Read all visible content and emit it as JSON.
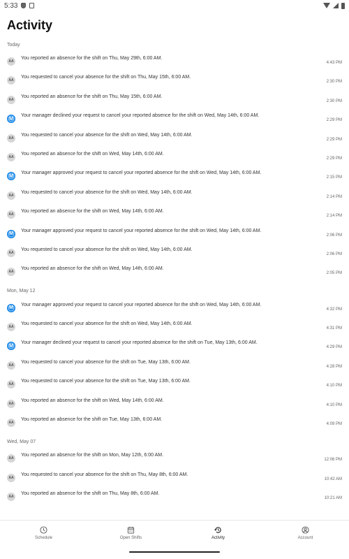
{
  "status_bar": {
    "time": "5:33"
  },
  "title": "Activity",
  "sections": [
    {
      "header": "Today",
      "rows": [
        {
          "avatar": "AA",
          "kind": "user",
          "text": "You reported an absence for the shift on Thu, May 29th, 6:00 AM.",
          "time": "4:43 PM"
        },
        {
          "avatar": "AA",
          "kind": "user",
          "text": "You requested to cancel your absence for the shift on Thu, May 15th, 6:00 AM.",
          "time": "2:30 PM"
        },
        {
          "avatar": "AA",
          "kind": "user",
          "text": "You reported an absence for the shift on Thu, May 15th, 6:00 AM.",
          "time": "2:30 PM"
        },
        {
          "avatar": "M",
          "kind": "manager",
          "text": "Your manager declined your request to cancel your reported absence for the shift on Wed, May 14th, 6:00 AM.",
          "time": "2:29 PM"
        },
        {
          "avatar": "AA",
          "kind": "user",
          "text": "You requested to cancel your absence for the shift on Wed, May 14th, 6:00 AM.",
          "time": "2:29 PM"
        },
        {
          "avatar": "AA",
          "kind": "user",
          "text": "You reported an absence for the shift on Wed, May 14th, 6:00 AM.",
          "time": "2:29 PM"
        },
        {
          "avatar": "M",
          "kind": "manager",
          "text": "Your manager approved your request to cancel your reported absence for the shift on Wed, May 14th, 6:00 AM.",
          "time": "2:15 PM"
        },
        {
          "avatar": "AA",
          "kind": "user",
          "text": "You requested to cancel your absence for the shift on Wed, May 14th, 6:00 AM.",
          "time": "2:14 PM"
        },
        {
          "avatar": "AA",
          "kind": "user",
          "text": "You reported an absence for the shift on Wed, May 14th, 6:00 AM.",
          "time": "2:14 PM"
        },
        {
          "avatar": "M",
          "kind": "manager",
          "text": "Your manager approved your request to cancel your reported absence for the shift on Wed, May 14th, 6:00 AM.",
          "time": "2:06 PM"
        },
        {
          "avatar": "AA",
          "kind": "user",
          "text": "You requested to cancel your absence for the shift on Wed, May 14th, 6:00 AM.",
          "time": "2:06 PM"
        },
        {
          "avatar": "AA",
          "kind": "user",
          "text": "You reported an absence for the shift on Wed, May 14th, 6:00 AM.",
          "time": "2:05 PM"
        }
      ]
    },
    {
      "header": "Mon, May 12",
      "rows": [
        {
          "avatar": "M",
          "kind": "manager",
          "text": "Your manager approved your request to cancel your reported absence for the shift on Wed, May 14th, 6:00 AM.",
          "time": "4:32 PM"
        },
        {
          "avatar": "AA",
          "kind": "user",
          "text": "You requested to cancel your absence for the shift on Wed, May 14th, 6:00 AM.",
          "time": "4:31 PM"
        },
        {
          "avatar": "M",
          "kind": "manager",
          "text": "Your manager declined your request to cancel your reported absence for the shift on Tue, May 13th, 6:00 AM.",
          "time": "4:29 PM"
        },
        {
          "avatar": "AA",
          "kind": "user",
          "text": "You requested to cancel your absence for the shift on Tue, May 13th, 6:00 AM.",
          "time": "4:28 PM"
        },
        {
          "avatar": "AA",
          "kind": "user",
          "text": "You requested to cancel your absence for the shift on Tue, May 13th, 6:00 AM.",
          "time": "4:10 PM"
        },
        {
          "avatar": "AA",
          "kind": "user",
          "text": "You reported an absence for the shift on Wed, May 14th, 6:00 AM.",
          "time": "4:10 PM"
        },
        {
          "avatar": "AA",
          "kind": "user",
          "text": "You reported an absence for the shift on Tue, May 13th, 6:00 AM.",
          "time": "4:09 PM"
        }
      ]
    },
    {
      "header": "Wed, May 07",
      "rows": [
        {
          "avatar": "AA",
          "kind": "user",
          "text": "You reported an absence for the shift on Mon, May 12th, 6:00 AM.",
          "time": "12:06 PM"
        },
        {
          "avatar": "AA",
          "kind": "user",
          "text": "You requested to cancel your absence for the shift on Thu, May 8th, 6:00 AM.",
          "time": "10:42 AM"
        },
        {
          "avatar": "AA",
          "kind": "user",
          "text": "You reported an absence for the shift on Thu, May 8th, 6:00 AM.",
          "time": "10:21 AM"
        }
      ]
    }
  ],
  "nav": [
    {
      "label": "Schedule",
      "icon": "clock-icon",
      "active": false
    },
    {
      "label": "Open Shifts",
      "icon": "calendar-icon",
      "active": false
    },
    {
      "label": "Activity",
      "icon": "history-icon",
      "active": true
    },
    {
      "label": "Account",
      "icon": "account-icon",
      "active": false
    }
  ],
  "colors": {
    "manager_avatar": "#1e88e5",
    "user_avatar": "#d6d6d6"
  }
}
